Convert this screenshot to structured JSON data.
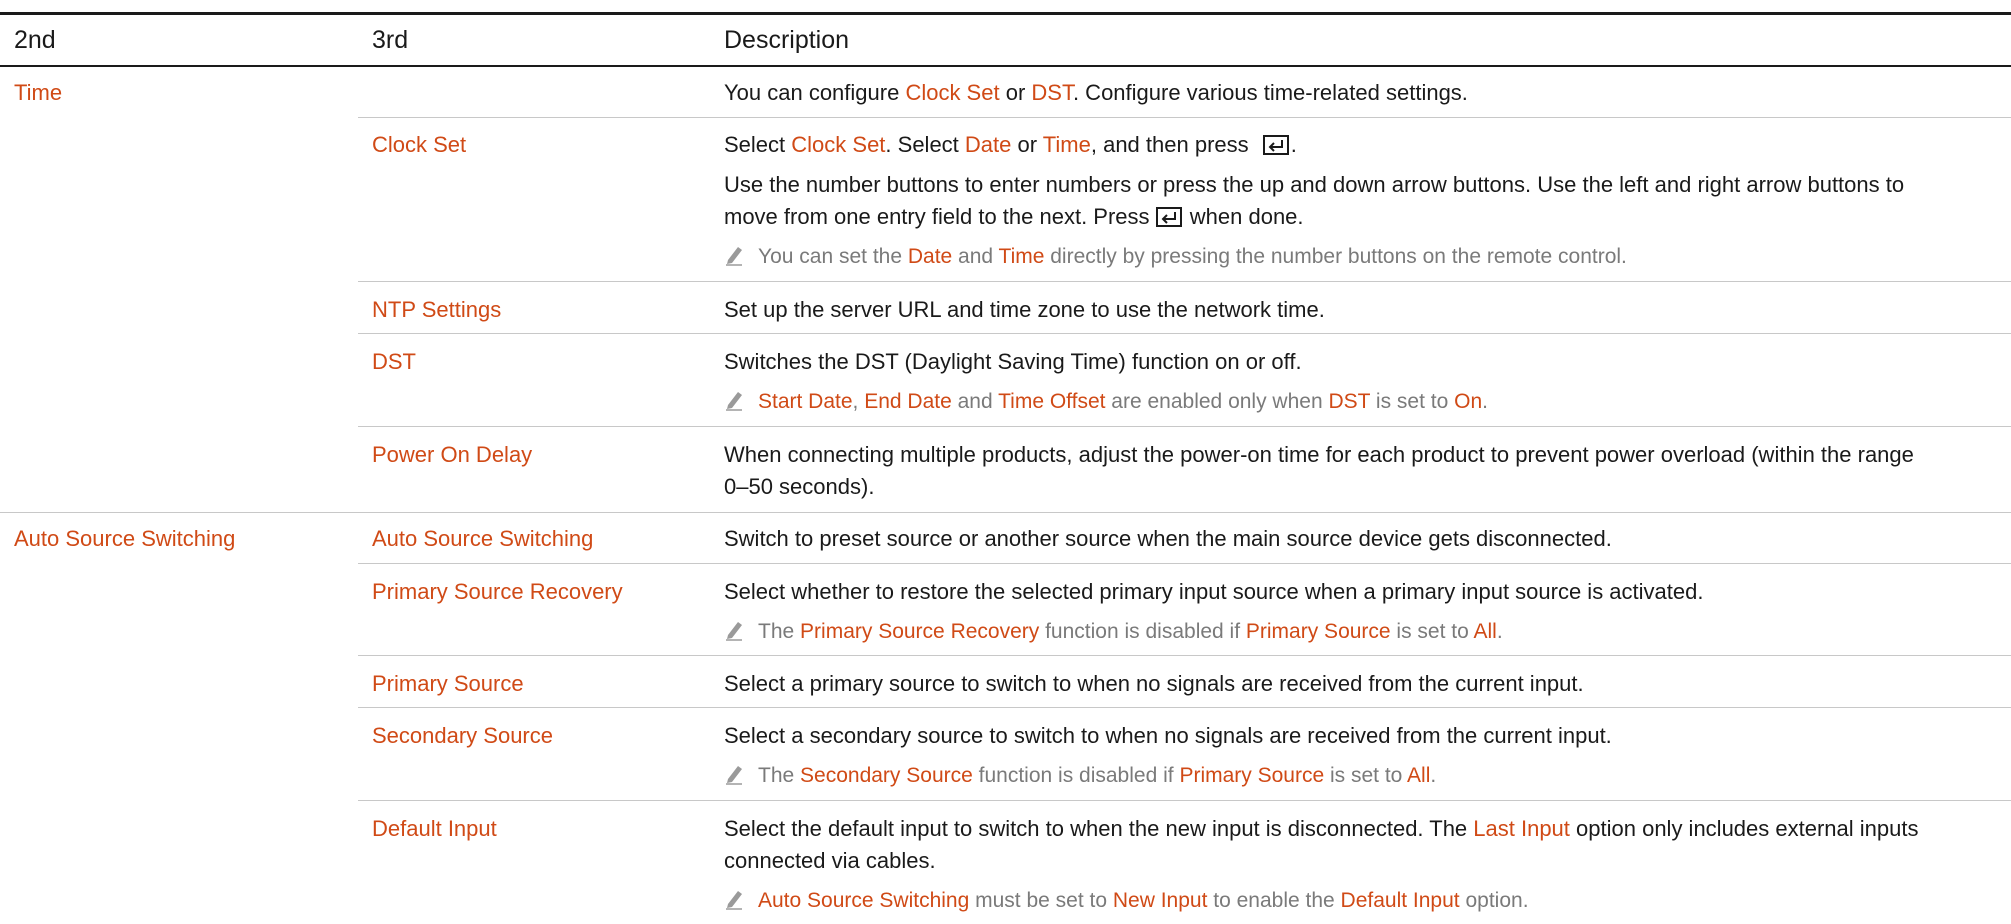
{
  "table": {
    "headers": [
      "2nd",
      "3rd",
      "Description"
    ],
    "groups": [
      {
        "label": "Time",
        "intro": [
          "You can configure ",
          "Clock Set",
          " or ",
          "DST",
          ". Configure various time-related settings."
        ],
        "rows": [
          {
            "label": "Clock Set",
            "desc1": [
              "Select ",
              "Clock Set",
              ". Select ",
              "Date",
              " or ",
              "Time",
              ", and then press "
            ],
            "desc1_end": ".",
            "desc2_line1": "Use the number buttons to enter numbers or press the up and down arrow buttons. Use the left and right arrow buttons to",
            "desc2_line2a": "move from one entry field to the next. Press ",
            "desc2_line2b": " when done.",
            "note": [
              "You can set the ",
              "Date",
              " and ",
              "Time",
              " directly by pressing the number buttons on the remote control."
            ]
          },
          {
            "label": "NTP Settings",
            "desc": "Set up the server URL and time zone to use the network time."
          },
          {
            "label": "DST",
            "desc": "Switches the DST (Daylight Saving Time) function on or off.",
            "note": [
              "Start Date",
              ", ",
              "End Date",
              " and ",
              "Time Offset",
              " are enabled only when ",
              "DST",
              " is set to ",
              "On",
              "."
            ]
          },
          {
            "label": "Power On Delay",
            "desc_line1": "When connecting multiple products, adjust the power-on time for each product to prevent power overload (within the range",
            "desc_line2": "0–50 seconds)."
          }
        ]
      },
      {
        "label": "Auto Source Switching",
        "rows": [
          {
            "label": "Auto Source Switching",
            "desc": "Switch to preset source or another source when the main source device gets disconnected."
          },
          {
            "label": "Primary Source Recovery",
            "desc": "Select whether to restore the selected primary input source when a primary input source is activated.",
            "note": [
              "The ",
              "Primary Source Recovery",
              " function is disabled if ",
              "Primary Source",
              " is set to ",
              "All",
              "."
            ]
          },
          {
            "label": "Primary Source",
            "desc": "Select a primary source to switch to when no signals are received from the current input."
          },
          {
            "label": "Secondary Source",
            "desc": "Select a secondary source to switch to when no signals are received from the current input.",
            "note": [
              "The ",
              "Secondary Source",
              " function is disabled if ",
              "Primary Source",
              " is set to ",
              "All",
              "."
            ]
          },
          {
            "label": "Default Input",
            "desc_line1": [
              "Select the default input to switch to when the new input is disconnected. The ",
              "Last Input",
              " option only includes external inputs"
            ],
            "desc_line2": "connected via cables.",
            "note": [
              "Auto Source Switching",
              " must be set to ",
              "New Input",
              " to enable the ",
              "Default Input",
              " option."
            ]
          }
        ]
      }
    ]
  },
  "icons": {
    "enter": "enter-key-icon",
    "note": "pencil-note-icon"
  },
  "colors": {
    "highlight": "#d04a16",
    "text": "#1a1a1a",
    "note_text": "#7a7a7a",
    "rule": "#c8c8c8"
  }
}
